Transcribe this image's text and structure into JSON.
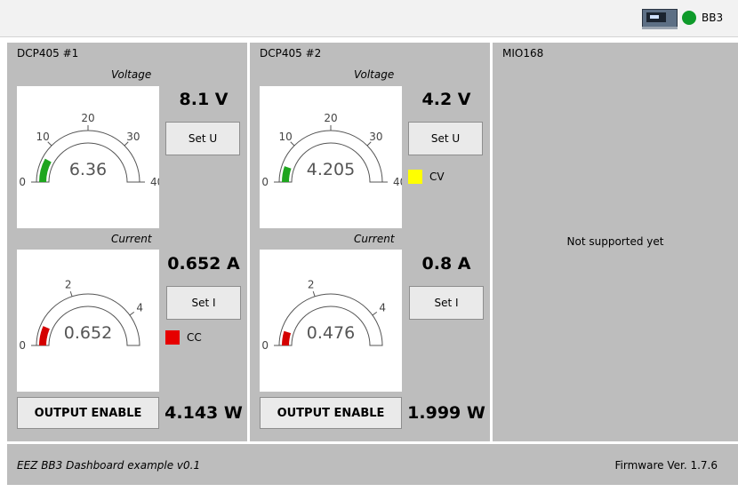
{
  "topbar": {
    "device_name": "BB3",
    "status_color": "#0e9a2a"
  },
  "channels": [
    {
      "title": "DCP405 #1",
      "voltage": {
        "caption": "Voltage",
        "gauge_value": "6.36",
        "value": 6.36,
        "min": 0,
        "max": 40,
        "ticks": [
          "0",
          "10",
          "20",
          "30",
          "40"
        ],
        "reading": "8.1 V",
        "button": "Set U",
        "indicator": null
      },
      "current": {
        "caption": "Current",
        "gauge_value": "0.652",
        "value": 0.652,
        "min": 0,
        "max": 5,
        "ticks": [
          "0",
          "2",
          "4"
        ],
        "reading": "0.652 A",
        "button": "Set I",
        "indicator": {
          "label": "CC",
          "color": "#e60000"
        }
      },
      "output_button": "OUTPUT ENABLE",
      "power": "4.143 W"
    },
    {
      "title": "DCP405 #2",
      "voltage": {
        "caption": "Voltage",
        "gauge_value": "4.205",
        "value": 4.205,
        "min": 0,
        "max": 40,
        "ticks": [
          "0",
          "10",
          "20",
          "30",
          "40"
        ],
        "reading": "4.2 V",
        "button": "Set U",
        "indicator": {
          "label": "CV",
          "color": "#ffff00"
        }
      },
      "current": {
        "caption": "Current",
        "gauge_value": "0.476",
        "value": 0.476,
        "min": 0,
        "max": 5,
        "ticks": [
          "0",
          "2",
          "4"
        ],
        "reading": "0.8 A",
        "button": "Set I",
        "indicator": null
      },
      "output_button": "OUTPUT ENABLE",
      "power": "1.999 W"
    }
  ],
  "mio": {
    "title": "MIO168",
    "message": "Not supported yet"
  },
  "footer": {
    "left": "EEZ BB3 Dashboard example v0.1",
    "right": "Firmware Ver. 1.7.6"
  },
  "colors": {
    "voltage_bar": "#1ea51e",
    "current_bar": "#d40000",
    "panel_bg": "#bdbdbd"
  }
}
